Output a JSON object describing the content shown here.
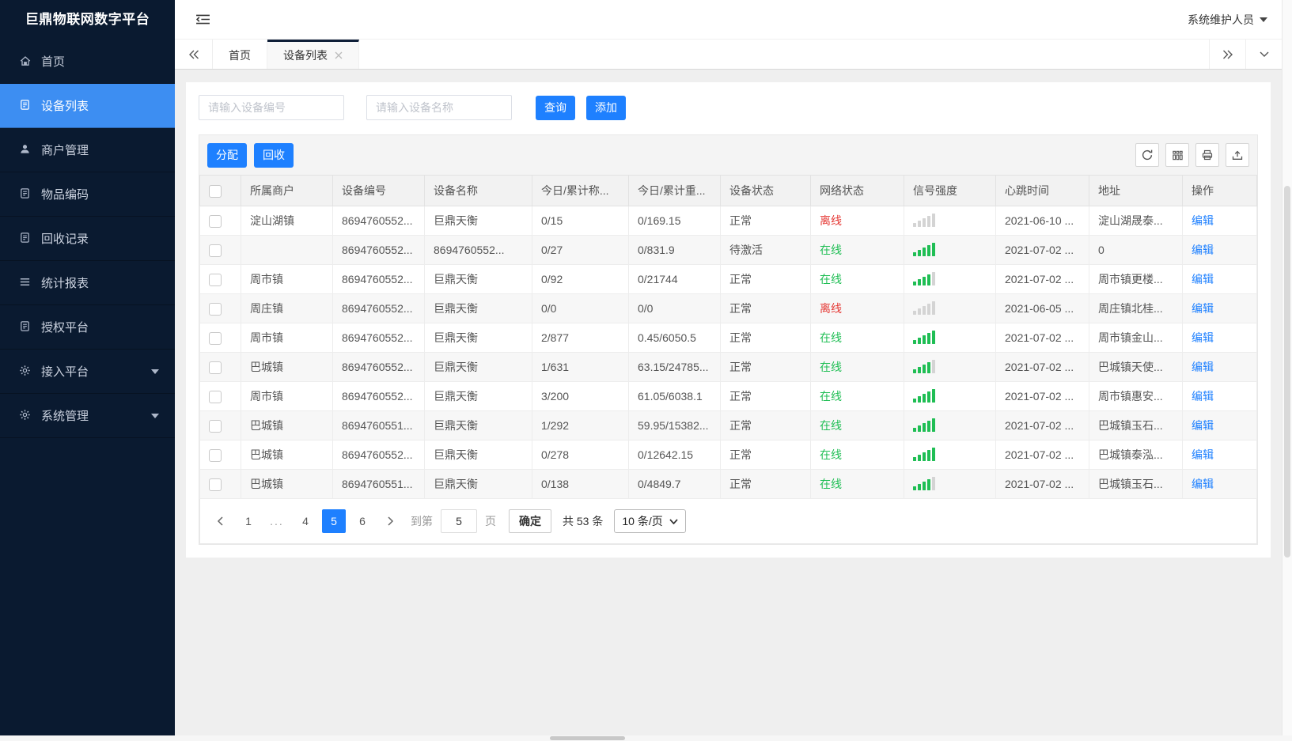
{
  "app": {
    "title": "巨鼎物联网数字平台",
    "user_role": "系统维护人员"
  },
  "sidebar": {
    "items": [
      {
        "key": "home",
        "label": "首页",
        "icon": "home-icon",
        "active": false,
        "has_submenu": false
      },
      {
        "key": "device-list",
        "label": "设备列表",
        "icon": "doc-icon",
        "active": true,
        "has_submenu": false
      },
      {
        "key": "merchant-mgmt",
        "label": "商户管理",
        "icon": "user-icon",
        "active": false,
        "has_submenu": false
      },
      {
        "key": "item-code",
        "label": "物品编码",
        "icon": "doc-icon",
        "active": false,
        "has_submenu": false
      },
      {
        "key": "recycle-records",
        "label": "回收记录",
        "icon": "doc-icon",
        "active": false,
        "has_submenu": false
      },
      {
        "key": "statistics",
        "label": "统计报表",
        "icon": "list-icon",
        "active": false,
        "has_submenu": false
      },
      {
        "key": "auth-platform",
        "label": "授权平台",
        "icon": "doc-icon",
        "active": false,
        "has_submenu": false
      },
      {
        "key": "access-platform",
        "label": "接入平台",
        "icon": "gear-icon",
        "active": false,
        "has_submenu": true
      },
      {
        "key": "system-mgmt",
        "label": "系统管理",
        "icon": "gear-icon",
        "active": false,
        "has_submenu": true
      }
    ]
  },
  "tabbar": {
    "tabs": [
      {
        "key": "home",
        "label": "首页",
        "active": false,
        "closable": false
      },
      {
        "key": "device-list",
        "label": "设备列表",
        "active": true,
        "closable": true
      }
    ]
  },
  "search": {
    "device_no_placeholder": "请输入设备编号",
    "device_name_placeholder": "请输入设备名称",
    "query_label": "查询",
    "add_label": "添加"
  },
  "toolbar": {
    "assign_label": "分配",
    "recycle_label": "回收"
  },
  "table": {
    "columns": [
      "所属商户",
      "设备编号",
      "设备名称",
      "今日/累计称...",
      "今日/累计重...",
      "设备状态",
      "网络状态",
      "信号强度",
      "心跳时间",
      "地址",
      "操作"
    ],
    "rows": [
      {
        "merchant": "淀山湖镇",
        "device_no": "8694760552...",
        "device_name": "巨鼎天衡",
        "today_total_count": "0/15",
        "today_total_weight": "0/169.15",
        "device_status": "正常",
        "network_status": "离线",
        "signal_level": 0,
        "heartbeat": "2021-06-10 ...",
        "address": "淀山湖晟泰...",
        "action": "编辑"
      },
      {
        "merchant": "",
        "device_no": "8694760552...",
        "device_name": "8694760552...",
        "today_total_count": "0/27",
        "today_total_weight": "0/831.9",
        "device_status": "待激活",
        "network_status": "在线",
        "signal_level": 5,
        "heartbeat": "2021-07-02 ...",
        "address": "0",
        "action": "编辑"
      },
      {
        "merchant": "周市镇",
        "device_no": "8694760552...",
        "device_name": "巨鼎天衡",
        "today_total_count": "0/92",
        "today_total_weight": "0/21744",
        "device_status": "正常",
        "network_status": "在线",
        "signal_level": 4,
        "heartbeat": "2021-07-02 ...",
        "address": "周市镇更楼...",
        "action": "编辑"
      },
      {
        "merchant": "周庄镇",
        "device_no": "8694760552...",
        "device_name": "巨鼎天衡",
        "today_total_count": "0/0",
        "today_total_weight": "0/0",
        "device_status": "正常",
        "network_status": "离线",
        "signal_level": 0,
        "heartbeat": "2021-06-05 ...",
        "address": "周庄镇北桂...",
        "action": "编辑"
      },
      {
        "merchant": "周市镇",
        "device_no": "8694760552...",
        "device_name": "巨鼎天衡",
        "today_total_count": "2/877",
        "today_total_weight": "0.45/6050.5",
        "device_status": "正常",
        "network_status": "在线",
        "signal_level": 5,
        "heartbeat": "2021-07-02 ...",
        "address": "周市镇金山...",
        "action": "编辑"
      },
      {
        "merchant": "巴城镇",
        "device_no": "8694760552...",
        "device_name": "巨鼎天衡",
        "today_total_count": "1/631",
        "today_total_weight": "63.15/24785...",
        "device_status": "正常",
        "network_status": "在线",
        "signal_level": 4,
        "heartbeat": "2021-07-02 ...",
        "address": "巴城镇天使...",
        "action": "编辑"
      },
      {
        "merchant": "周市镇",
        "device_no": "8694760552...",
        "device_name": "巨鼎天衡",
        "today_total_count": "3/200",
        "today_total_weight": "61.05/6038.1",
        "device_status": "正常",
        "network_status": "在线",
        "signal_level": 5,
        "heartbeat": "2021-07-02 ...",
        "address": "周市镇惠安...",
        "action": "编辑"
      },
      {
        "merchant": "巴城镇",
        "device_no": "8694760551...",
        "device_name": "巨鼎天衡",
        "today_total_count": "1/292",
        "today_total_weight": "59.95/15382...",
        "device_status": "正常",
        "network_status": "在线",
        "signal_level": 5,
        "heartbeat": "2021-07-02 ...",
        "address": "巴城镇玉石...",
        "action": "编辑"
      },
      {
        "merchant": "巴城镇",
        "device_no": "8694760552...",
        "device_name": "巨鼎天衡",
        "today_total_count": "0/278",
        "today_total_weight": "0/12642.15",
        "device_status": "正常",
        "network_status": "在线",
        "signal_level": 5,
        "heartbeat": "2021-07-02 ...",
        "address": "巴城镇泰泓...",
        "action": "编辑"
      },
      {
        "merchant": "巴城镇",
        "device_no": "8694760551...",
        "device_name": "巨鼎天衡",
        "today_total_count": "0/138",
        "today_total_weight": "0/4849.7",
        "device_status": "正常",
        "network_status": "在线",
        "signal_level": 4,
        "heartbeat": "2021-07-02 ...",
        "address": "巴城镇玉石...",
        "action": "编辑"
      }
    ]
  },
  "pagination": {
    "pages": [
      {
        "label": "1",
        "active": false,
        "ellipsis": false
      },
      {
        "label": "...",
        "active": false,
        "ellipsis": true
      },
      {
        "label": "4",
        "active": false,
        "ellipsis": false
      },
      {
        "label": "5",
        "active": true,
        "ellipsis": false
      },
      {
        "label": "6",
        "active": false,
        "ellipsis": false
      }
    ],
    "goto_label": "到第",
    "goto_value": "5",
    "page_unit_label": "页",
    "confirm_label": "确定",
    "total_label": "共 53 条",
    "page_size_label": "10 条/页"
  },
  "colors": {
    "accent_blue": "#1e80ff",
    "sidebar_bg": "#0a1a30",
    "sidebar_active": "#3d8ef2",
    "online_green": "#1fbe54",
    "offline_red": "#e53935"
  }
}
